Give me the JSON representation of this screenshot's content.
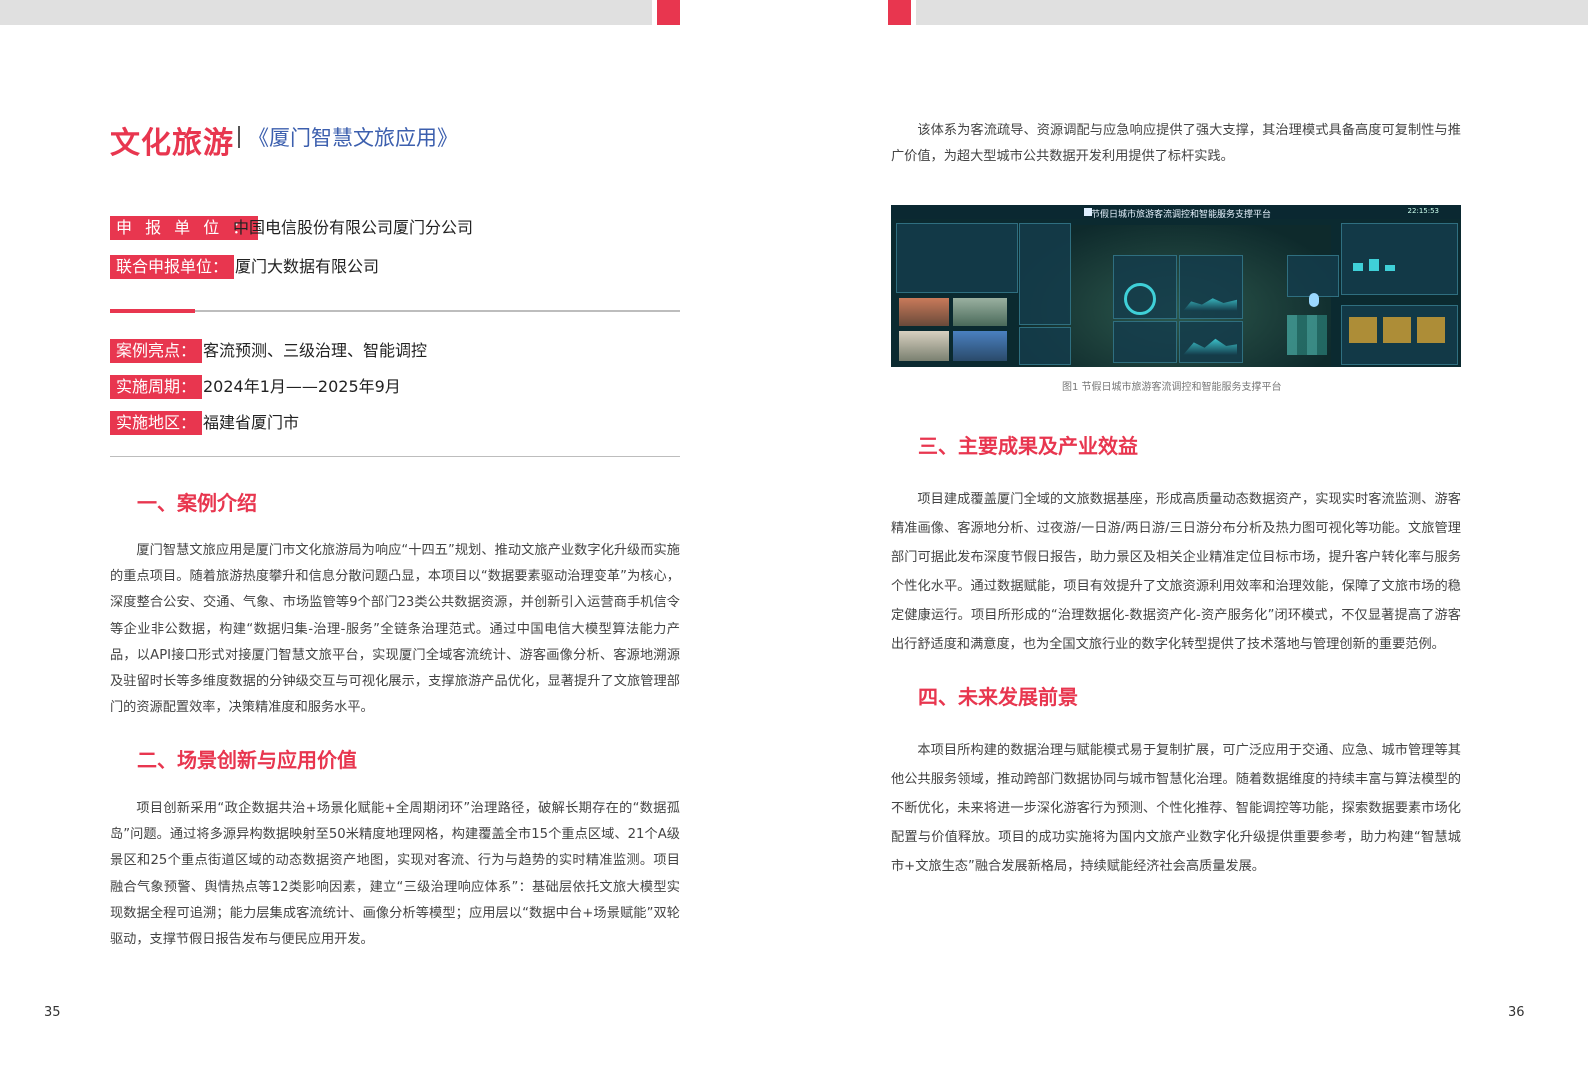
{
  "left_page": {
    "title": "文化旅游",
    "subtitle": "《厦门智慧文旅应用》",
    "info": [
      {
        "label": "申 报 单 位 ：",
        "value": "中国电信股份有限公司厦门分公司"
      },
      {
        "label": "联合申报单位：",
        "value": "厦门大数据有限公司"
      }
    ],
    "details": [
      {
        "label": "案例亮点：",
        "value": "客流预测、三级治理、智能调控"
      },
      {
        "label": "实施周期：",
        "value": "2024年1月——2025年9月"
      },
      {
        "label": "实施地区：",
        "value": "福建省厦门市"
      }
    ],
    "section1": {
      "heading": "一、案例介绍",
      "text": "厦门智慧文旅应用是厦门市文化旅游局为响应“十四五”规划、推动文旅产业数字化升级而实施的重点项目。随着旅游热度攀升和信息分散问题凸显，本项目以“数据要素驱动治理变革”为核心，深度整合公安、交通、气象、市场监管等9个部门23类公共数据资源，并创新引入运营商手机信令等企业非公数据，构建“数据归集-治理-服务”全链条治理范式。通过中国电信大模型算法能力产品，以API接口形式对接厦门智慧文旅平台，实现厦门全域客流统计、游客画像分析、客源地溯源及驻留时长等多维度数据的分钟级交互与可视化展示，支撑旅游产品优化，显著提升了文旅管理部门的资源配置效率，决策精准度和服务水平。"
    },
    "section2": {
      "heading": "二、场景创新与应用价值",
      "text": "项目创新采用“政企数据共治+场景化赋能+全周期闭环”治理路径，破解长期存在的“数据孤岛”问题。通过将多源异构数据映射至50米精度地理网格，构建覆盖全市15个重点区域、21个A级景区和25个重点街道区域的动态数据资产地图，实现对客流、行为与趋势的实时精准监测。项目融合气象预警、舆情热点等12类影响因素，建立“三级治理响应体系”：基础层依托文旅大模型实现数据全程可追溯；能力层集成客流统计、画像分析等模型；应用层以“数据中台+场景赋能”双轮驱动，支撑节假日报告发布与便民应用开发。"
    },
    "page_number": "35"
  },
  "right_page": {
    "intro_text": "该体系为客流疏导、资源调配与应急响应提供了强大支撑，其治理模式具备高度可复制性与推广价值，为超大型城市公共数据开发利用提供了标杆实践。",
    "figure": {
      "dashboard_title": "节假日城市旅游客流调控和智能服务支撑平台",
      "time": "22:15:53",
      "caption": "图1 节假日城市旅游客流调控和智能服务支撑平台"
    },
    "section3": {
      "heading": "三、主要成果及产业效益",
      "text": "项目建成覆盖厦门全域的文旅数据基座，形成高质量动态数据资产，实现实时客流监测、游客精准画像、客源地分析、过夜游/一日游/两日游/三日游分布分析及热力图可视化等功能。文旅管理部门可据此发布深度节假日报告，助力景区及相关企业精准定位目标市场，提升客户转化率与服务个性化水平。通过数据赋能，项目有效提升了文旅资源利用效率和治理效能，保障了文旅市场的稳定健康运行。项目所形成的“治理数据化-数据资产化-资产服务化”闭环模式，不仅显著提高了游客出行舒适度和满意度，也为全国文旅行业的数字化转型提供了技术落地与管理创新的重要范例。"
    },
    "section4": {
      "heading": "四、未来发展前景",
      "text": "本项目所构建的数据治理与赋能模式易于复制扩展，可广泛应用于交通、应急、城市管理等其他公共服务领域，推动跨部门数据协同与城市智慧化治理。随着数据维度的持续丰富与算法模型的不断优化，未来将进一步深化游客行为预测、个性化推荐、智能调控等功能，探索数据要素市场化配置与价值释放。项目的成功实施将为国内文旅产业数字化升级提供重要参考，助力构建“智慧城市+文旅生态”融合发展新格局，持续赋能经济社会高质量发展。"
    },
    "page_number": "36"
  },
  "colors": {
    "accent": "#e8364f",
    "subtitle_blue": "#3c5fae",
    "header_gray": "#e0e0e0"
  }
}
